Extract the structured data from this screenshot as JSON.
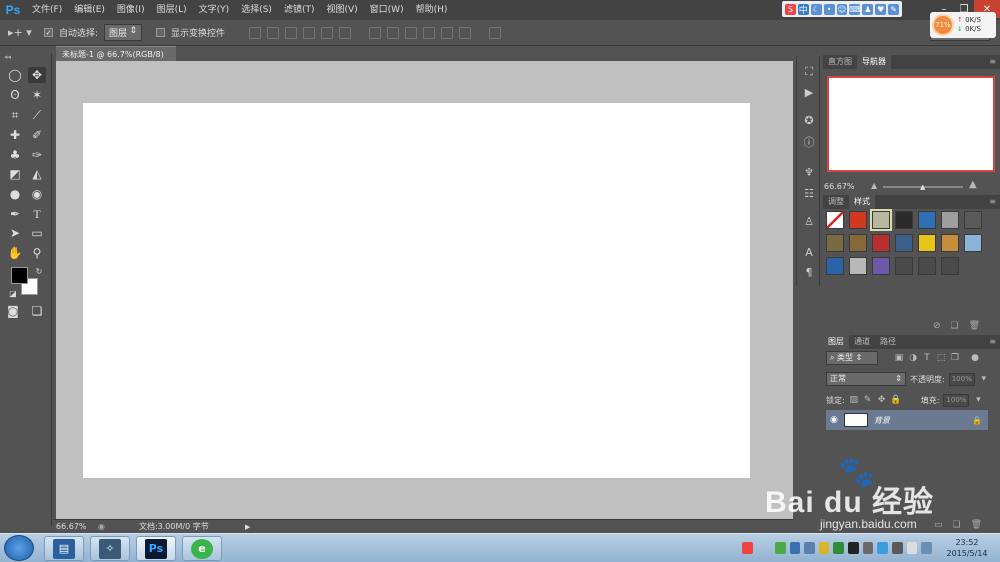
{
  "app": {
    "logo": "Ps"
  },
  "menu": [
    "文件(F)",
    "编辑(E)",
    "图像(I)",
    "图层(L)",
    "文字(Y)",
    "选择(S)",
    "滤镜(T)",
    "视图(V)",
    "窗口(W)",
    "帮助(H)"
  ],
  "top_tray": {
    "ime_label": "中"
  },
  "speed_widget": {
    "percent": "71%",
    "up": "0K/S",
    "down": "0K/S"
  },
  "options": {
    "auto_select_label": "自动选择:",
    "auto_select_value": "图层",
    "show_transform_label": "显示变换控件",
    "workspace_label": "基本功能"
  },
  "document": {
    "tab_title": "未标题-1 @ 66.7%(RGB/8)",
    "status_zoom": "66.67%",
    "status_doc": "文档:3.00M/0 字节"
  },
  "navigator": {
    "tabs": [
      "直方图",
      "导航器"
    ],
    "active_tab": "导航器",
    "zoom": "66.67%"
  },
  "styles": {
    "tabs": [
      "调整",
      "样式"
    ],
    "active_tab": "样式",
    "swatch_colors": [
      "#ffffff",
      "#d2381f",
      "#b7b7a2",
      "#2b2b2b",
      "#2f6fb6",
      "#9e9e9e",
      "#5a5a5a",
      "#7a6a42",
      "#86683a",
      "#b72f2f",
      "#3a5f8a",
      "#e6c418",
      "#c68d3a",
      "#8ab3d9",
      "#2a64a8",
      "#b8b8b8",
      "#6a5aa8",
      "#4a4a4a",
      "#4a4a4a",
      "#4a4a4a"
    ]
  },
  "layers": {
    "tabs": [
      "图层",
      "通道",
      "路径"
    ],
    "active_tab": "图层",
    "filter_label": "类型",
    "blend_mode": "正常",
    "opacity_label": "不透明度:",
    "opacity_value": "100%",
    "lock_label": "锁定:",
    "fill_label": "填充:",
    "fill_value": "100%",
    "layer_name": "背景"
  },
  "taskbar": {
    "ps_label": "Ps",
    "time": "23:52",
    "date": "2015/5/14"
  },
  "watermark": {
    "logo_text": "Bai du 经验",
    "url": "jingyan.baidu.com"
  }
}
